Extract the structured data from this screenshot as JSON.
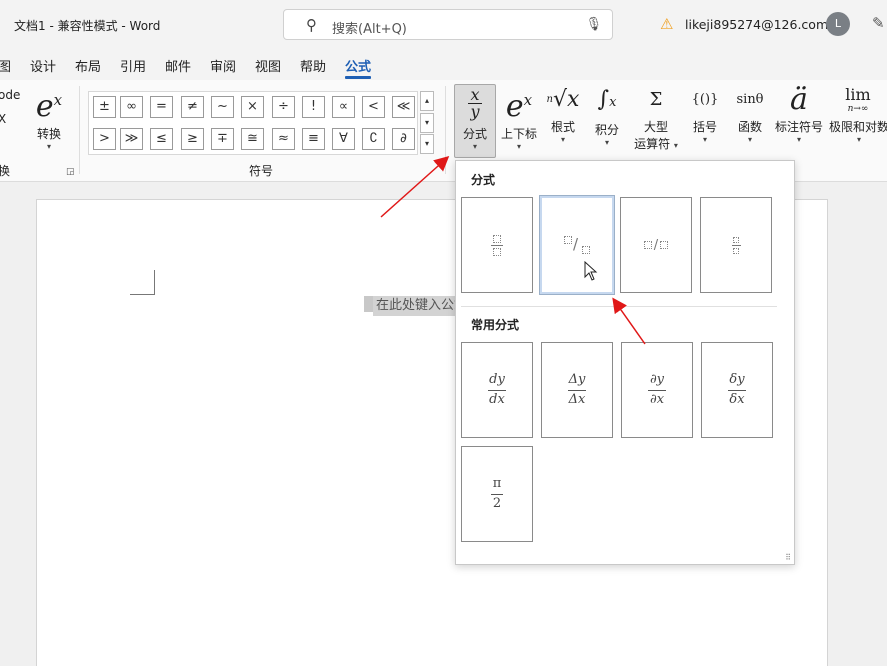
{
  "titlebar": {
    "doc_title": "文档1  -  兼容性模式  -  Word",
    "search_placeholder": "搜索(Alt+Q)",
    "account": "likeji895274@126.com",
    "avatar_letter": "L"
  },
  "menu": {
    "tabs": [
      "图",
      "设计",
      "布局",
      "引用",
      "邮件",
      "审阅",
      "视图",
      "帮助",
      "公式"
    ],
    "active": "公式"
  },
  "ribbon": {
    "left_partial": [
      "ode",
      "X",
      "换"
    ],
    "convert_label": "转换",
    "symbols_group_label": "符号",
    "symbols_row1": [
      "±",
      "∞",
      "=",
      "≠",
      "~",
      "×",
      "÷",
      "!",
      "∝",
      "<",
      "≪"
    ],
    "symbols_row2": [
      ">",
      "≫",
      "≤",
      "≥",
      "∓",
      "≅",
      "≈",
      "≡",
      "∀",
      "∁",
      "∂"
    ],
    "buttons": {
      "fraction": "分式",
      "script": "上下标",
      "radical": "根式",
      "integral": "积分",
      "large_operator_1": "大型",
      "large_operator_2": "运算符",
      "bracket": "括号",
      "function": "函数",
      "accent": "标注符号",
      "limit": "极限和对数"
    },
    "glyphs": {
      "function": "sinθ",
      "limit_top": "lim",
      "limit_bottom": "n→∞",
      "bracket": "{()}",
      "accent": "ä"
    }
  },
  "document": {
    "equation_placeholder": "在此处键入公式。"
  },
  "dropdown": {
    "section1_title": "分式",
    "section2_title": "常用分式",
    "common_fractions": [
      {
        "num": "dy",
        "den": "dx"
      },
      {
        "num": "Δy",
        "den": "Δx"
      },
      {
        "num": "∂y",
        "den": "∂x"
      },
      {
        "num": "δy",
        "den": "δx"
      },
      {
        "num": "π",
        "den": "2"
      }
    ]
  }
}
